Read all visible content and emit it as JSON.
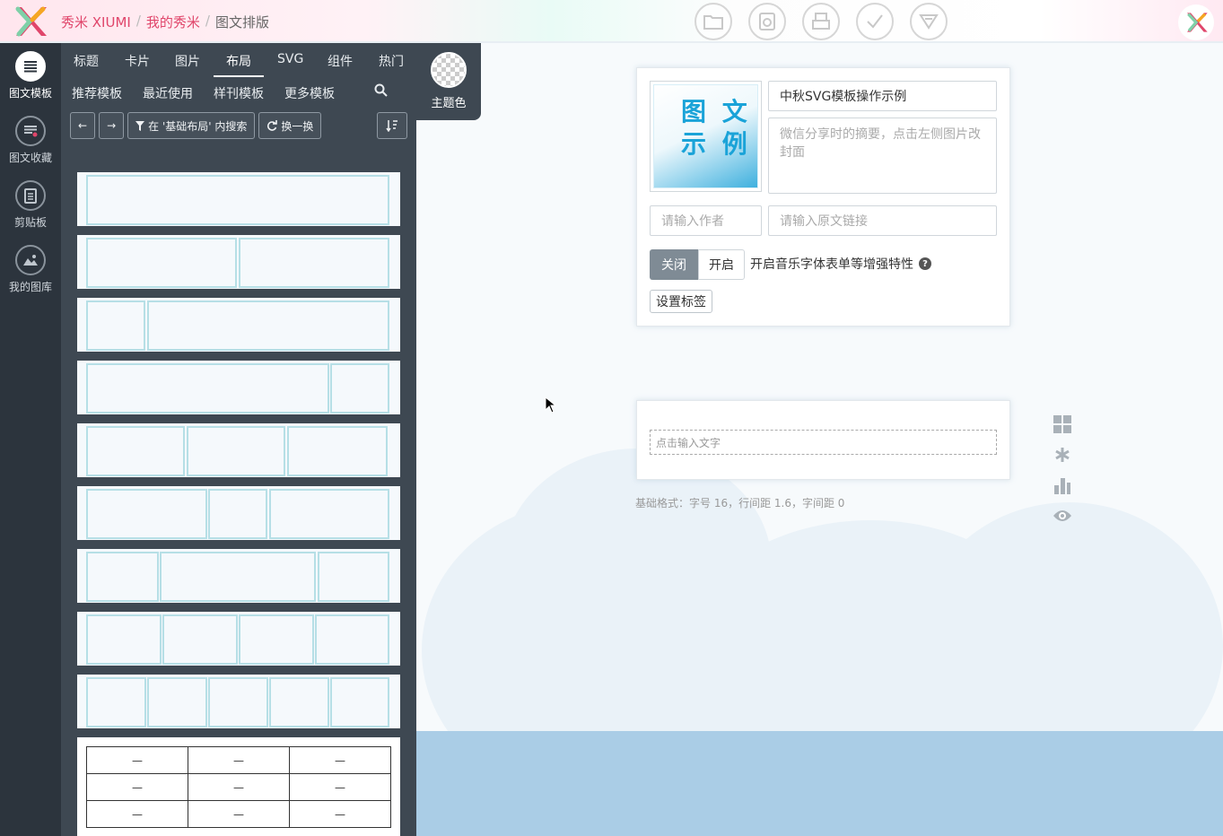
{
  "breadcrumb": {
    "items": [
      "秀米 XIUMI",
      "我的秀米",
      "图文排版"
    ],
    "separators": [
      "/",
      "/"
    ]
  },
  "top_icons": [
    "folder-icon",
    "preview-icon",
    "print-icon",
    "check-icon",
    "publish-icon"
  ],
  "rail": [
    {
      "label": "图文模板",
      "icon": "list-icon",
      "active": true
    },
    {
      "label": "图文收藏",
      "icon": "favorites-icon",
      "active": false
    },
    {
      "label": "剪贴板",
      "icon": "clipboard-icon",
      "active": false
    },
    {
      "label": "我的图库",
      "icon": "gallery-icon",
      "active": false
    }
  ],
  "tabs_row1": [
    "标题",
    "卡片",
    "图片",
    "布局",
    "SVG",
    "组件",
    "热门"
  ],
  "tabs_row2": [
    "推荐模板",
    "最近使用",
    "样刊模板",
    "更多模板"
  ],
  "active_tab": "布局",
  "toolbar": {
    "back": "←",
    "forward": "→",
    "filter_label": "在 '基础布局' 内搜索",
    "refresh_label": "换一换",
    "sort": "sort-icon"
  },
  "theme": {
    "label": "主题色"
  },
  "table_template": {
    "rows": [
      [
        "—",
        "—",
        "—"
      ],
      [
        "—",
        "—",
        "—"
      ],
      [
        "—",
        "—",
        "—"
      ]
    ]
  },
  "article": {
    "cover_text": "图 文\n示 例",
    "title": "中秋SVG模板操作示例",
    "summary_placeholder": "微信分享时的摘要，点击左侧图片改封面",
    "author_placeholder": "请输入作者",
    "link_placeholder": "请输入原文链接",
    "toggle_off": "关闭",
    "toggle_on": "开启",
    "enhance_label": "开启音乐字体表单等增强特性",
    "help": "?",
    "tag_button": "设置标签"
  },
  "editor": {
    "placeholder": "点击输入文字",
    "format": "基础格式：字号 16，行间距 1.6，字间距 0"
  },
  "side_tools": [
    "grid-icon",
    "asterisk-icon",
    "chart-icon",
    "eye-icon"
  ],
  "colors": {
    "brand": "#e0466b",
    "rail": "#2c343d",
    "panel": "#3e4852",
    "accent": "#1aa3d8"
  }
}
